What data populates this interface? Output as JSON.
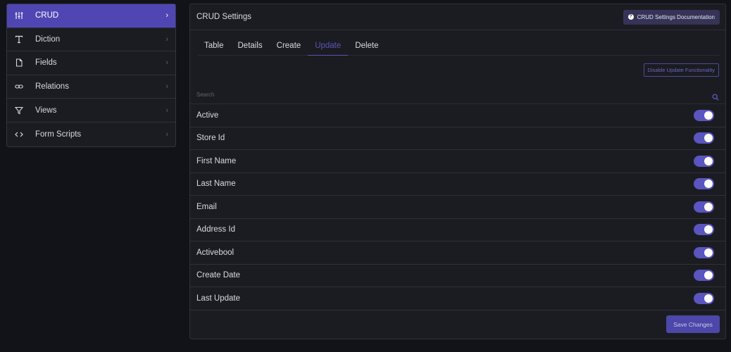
{
  "sidebar": {
    "items": [
      {
        "label": "CRUD",
        "icon": "sliders-icon"
      },
      {
        "label": "Diction",
        "icon": "text-icon"
      },
      {
        "label": "Fields",
        "icon": "file-icon"
      },
      {
        "label": "Relations",
        "icon": "link-icon"
      },
      {
        "label": "Views",
        "icon": "filter-icon"
      },
      {
        "label": "Form Scripts",
        "icon": "code-icon"
      }
    ],
    "active_index": 0
  },
  "panel": {
    "title": "CRUD Settings",
    "doc_button": "CRUD Settings Documentation",
    "tabs": [
      "Table",
      "Details",
      "Create",
      "Update",
      "Delete"
    ],
    "active_tab": "Update",
    "disable_button": "Disable Update Functionality",
    "search_placeholder": "Search",
    "fields": [
      {
        "label": "Active",
        "enabled": true
      },
      {
        "label": "Store Id",
        "enabled": true
      },
      {
        "label": "First Name",
        "enabled": true
      },
      {
        "label": "Last Name",
        "enabled": true
      },
      {
        "label": "Email",
        "enabled": true
      },
      {
        "label": "Address Id",
        "enabled": true
      },
      {
        "label": "Activebool",
        "enabled": true
      },
      {
        "label": "Create Date",
        "enabled": true
      },
      {
        "label": "Last Update",
        "enabled": true
      }
    ],
    "save_button": "Save Changes"
  },
  "colors": {
    "accent": "#4f46b3",
    "toggle_on": "#5a55bf",
    "background": "#121319",
    "panel": "#1b1c22"
  }
}
